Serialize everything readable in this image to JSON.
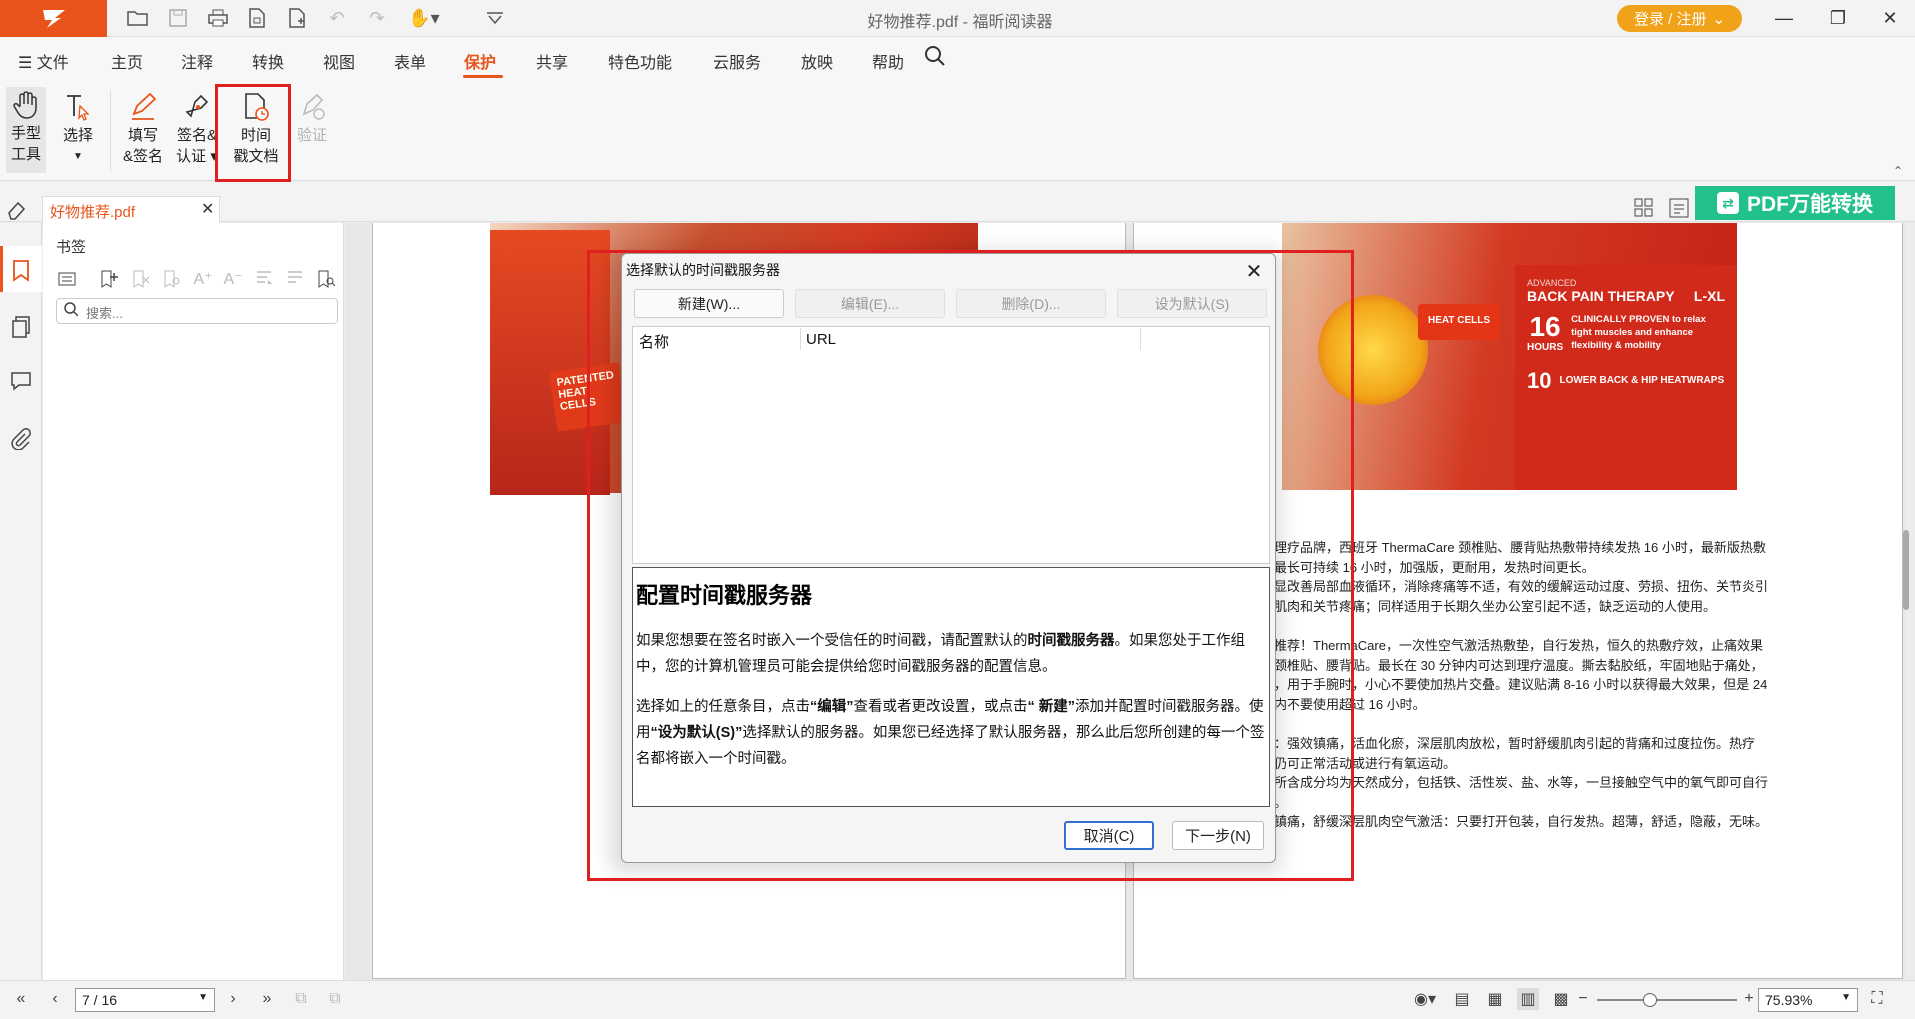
{
  "app": {
    "title": "好物推荐.pdf - 福昕阅读器",
    "login_label": "登录 / 注册"
  },
  "menu": [
    {
      "label": "文件"
    },
    {
      "label": "主页"
    },
    {
      "label": "注释"
    },
    {
      "label": "转换"
    },
    {
      "label": "视图"
    },
    {
      "label": "表单"
    },
    {
      "label": "保护"
    },
    {
      "label": "共享"
    },
    {
      "label": "特色功能"
    },
    {
      "label": "云服务"
    },
    {
      "label": "放映"
    },
    {
      "label": "帮助"
    }
  ],
  "active_menu": "保护",
  "ribbon": {
    "hand_tool": [
      "手型",
      "工具"
    ],
    "select": "选择",
    "fill_sign": [
      "填写",
      "&签名"
    ],
    "sign_cert": [
      "签名&",
      "认证"
    ],
    "timestamp": [
      "时间",
      "戳文档"
    ],
    "verify": "验证"
  },
  "tab": {
    "label": "好物推荐.pdf"
  },
  "pdf_convert": "PDF万能转换",
  "bookmarks": {
    "title": "书签",
    "search_placeholder": "搜索..."
  },
  "doc_lines": [
    "理疗品牌，西班牙 ThermaCare 颈椎贴、腰背贴热敷带持续发热 16 小时，最新版热敷",
    "最长可持续 16 小时，加强版，更耐用，发热时间更长。",
    "显改善局部血液循环，消除疼痛等不适，有效的缓解运动过度、劳损、扭伤、关节炎引",
    "肌肉和关节疼痛；同样适用于长期久坐办公室引起不适，缺乏运动的人使用。",
    "",
    "推荐！ThermaCare，一次性空气激活热敷垫，自行发热，恒久的热敷疗效，止痛效果",
    "颈椎贴、腰背贴。最长在 30 分钟内可达到理疗温度。撕去黏胶纸，牢固地贴于痛处，",
    "，用于手腕时，小心不要使加热片交叠。建议贴满 8-16 小时以获得最大效果，但是 24",
    "内不要使用超过 16 小时。",
    "",
    "：强效镇痛，活血化瘀，深层肌肉放松，暂时舒缓肌肉引起的背痛和过度拉伤。热疗",
    "仍可正常活动或进行有氧运动。",
    "所含成分均为天然成分，包括铁、活性炭、盐、水等，一旦接触空气中的氧气即可自行",
    "。",
    "镇痛，舒缓深层肌肉空气激活：只要打开包装，自行发热。超薄，舒适，隐蔽，无味。"
  ],
  "product_right": {
    "badge": "ADVANCED",
    "title": "BACK PAIN THERAPY",
    "size": "L-XL",
    "hours": "16",
    "hours_label": "HOURS",
    "claim": "CLINICALLY PROVEN to relax tight muscles and enhance flexibility & mobility",
    "count": "10",
    "wraps": "LOWER BACK & HIP HEATWRAPS",
    "heat_cells": "HEAT CELLS"
  },
  "product_left": {
    "label": "PATENTED HEAT CELLS"
  },
  "dialog": {
    "title": "选择默认的时间戳服务器",
    "buttons": {
      "new": "新建(W)...",
      "edit": "编辑(E)...",
      "delete": "删除(D)...",
      "set_default": "设为默认(S)"
    },
    "columns": {
      "name": "名称",
      "url": "URL"
    },
    "help_heading": "配置时间戳服务器",
    "help_p1_a": "如果您想要在签名时嵌入一个受信任的时间戳，请配置默认的",
    "help_p1_b": "时间戳服务器",
    "help_p1_c": "。如果您处于工作组中，您的计算机管理员可能会提供给您时间戳服务器的配置信息。",
    "help_p2_a": "选择如上的任意条目，点击",
    "help_p2_b": "“编辑”",
    "help_p2_c": "查看或者更改设置，或点击",
    "help_p2_d": "“ 新建”",
    "help_p2_e": "添加并配置时间戳服务器。使用",
    "help_p2_f": "“设为默认(S)”",
    "help_p2_g": "选择默认的服务器。如果您已经选择了默认服务器，那么此后您所创建的每一个签名都将嵌入一个时间戳。",
    "cancel": "取消(C)",
    "next": "下一步(N)"
  },
  "status": {
    "page": "7 / 16",
    "zoom": "75.93%"
  },
  "colors": {
    "accent": "#e8541c",
    "highlight": "#e02020",
    "convert": "#22c08a",
    "login": "#f0a218"
  }
}
